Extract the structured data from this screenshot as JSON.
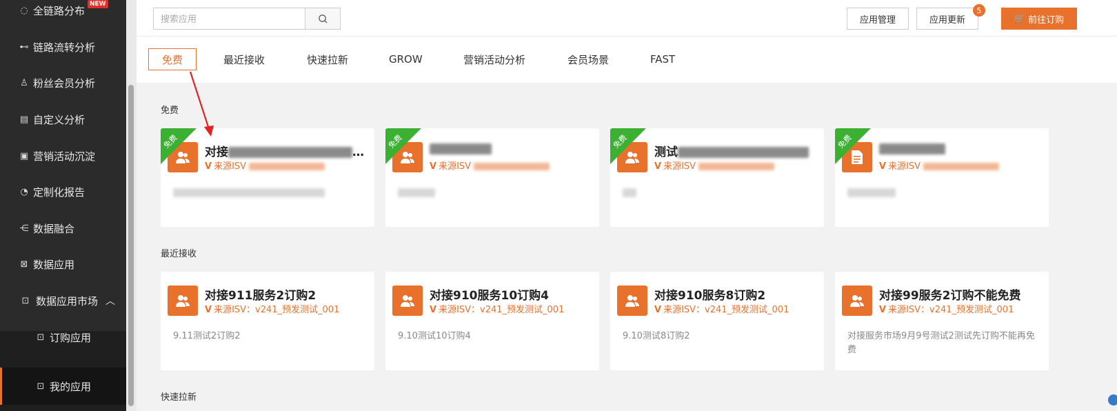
{
  "sidebar": {
    "items": [
      {
        "label": "全链路分布",
        "icon": "circle-spinner-icon"
      },
      {
        "label": "链路流转分析",
        "icon": "branch-icon"
      },
      {
        "label": "粉丝会员分析",
        "icon": "users-icon"
      },
      {
        "label": "自定义分析",
        "icon": "report-icon"
      },
      {
        "label": "营销活动沉淀",
        "icon": "clipboard-icon"
      },
      {
        "label": "定制化报告",
        "icon": "pie-icon"
      },
      {
        "label": "数据融合",
        "icon": "merge-icon"
      },
      {
        "label": "数据应用",
        "icon": "grid-icon"
      },
      {
        "label": "数据应用市场",
        "icon": "window-icon"
      },
      {
        "label": "订购应用",
        "icon": "window-icon"
      },
      {
        "label": "我的应用",
        "icon": "window-icon"
      }
    ],
    "new_badge": "NEW"
  },
  "header": {
    "search_placeholder": "搜索应用",
    "app_manage": "应用管理",
    "app_update": "应用更新",
    "update_count": "5",
    "buy": "前往订购"
  },
  "tabs": [
    "免费",
    "最近接收",
    "快速拉新",
    "GROW",
    "营销活动分析",
    "会员场景",
    "FAST"
  ],
  "sections": {
    "free": {
      "title": "免费",
      "ribbon": "免费",
      "cards": [
        {
          "title_prefix": "对接",
          "title_suffix": "…",
          "src_prefix": "来源ISV"
        },
        {
          "title_prefix": "",
          "title_suffix": "",
          "src_prefix": "来源ISV"
        },
        {
          "title_prefix": "测试",
          "title_suffix": "",
          "src_prefix": "来源ISV"
        },
        {
          "title_prefix": "",
          "title_suffix": "",
          "src_prefix": "来源ISV"
        }
      ]
    },
    "recent": {
      "title": "最近接收",
      "cards": [
        {
          "title": "对接911服务2订购2",
          "src": "来源ISV：v241_预发测试_001",
          "desc": "9.11测试2订购2"
        },
        {
          "title": "对接910服务10订购4",
          "src": "来源ISV：v241_预发测试_001",
          "desc": "9.10测试10订购4"
        },
        {
          "title": "对接910服务8订购2",
          "src": "来源ISV：v241_预发测试_001",
          "desc": "9.10测试8订购2"
        },
        {
          "title": "对接99服务2订购不能免费",
          "src": "来源ISV：v241_预发测试_001",
          "desc": "对接服务市场9月9号测试2测试先订购不能再免费"
        }
      ]
    },
    "quick": {
      "title": "快速拉新"
    }
  },
  "colors": {
    "accent": "#e8712c",
    "ribbon": "#3cb033",
    "sidebar": "#2b2b2b"
  }
}
